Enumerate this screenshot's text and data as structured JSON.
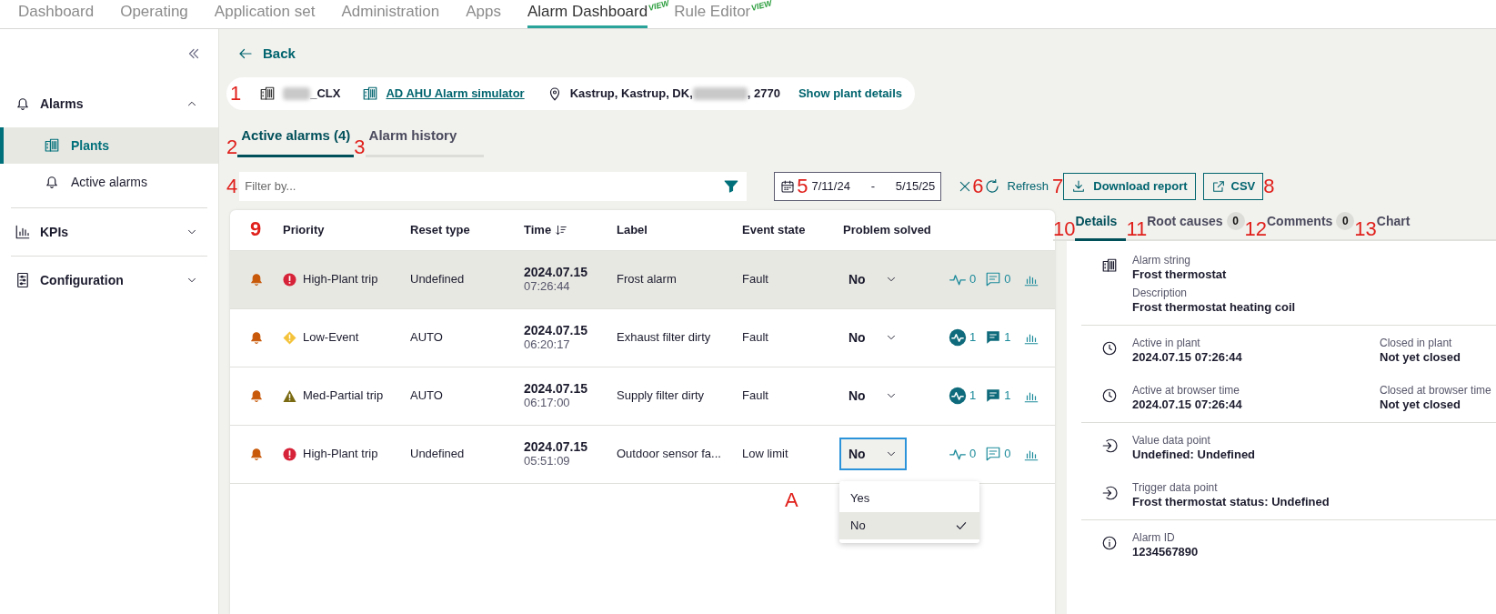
{
  "nav": [
    {
      "label": "Dashboard",
      "selected": false
    },
    {
      "label": "Operating",
      "selected": false
    },
    {
      "label": "Application set",
      "selected": false
    },
    {
      "label": "Administration",
      "selected": false
    },
    {
      "label": "Apps",
      "selected": false
    },
    {
      "label": "Alarm Dashboard",
      "selected": true,
      "badge": "VIEW"
    },
    {
      "label": "Rule Editor",
      "selected": false,
      "badge": "VIEW"
    }
  ],
  "sidebar": {
    "groups": [
      {
        "label": "Alarms",
        "expanded": true,
        "children": [
          {
            "label": "Plants",
            "selected": true
          },
          {
            "label": "Active alarms",
            "selected": false
          }
        ]
      },
      {
        "label": "KPIs",
        "expanded": false
      },
      {
        "label": "Configuration",
        "expanded": false
      }
    ]
  },
  "back": "Back",
  "plant_bar": {
    "callout": "1",
    "site": "_CLX",
    "plant_link": "AD AHU Alarm simulator",
    "address_start": "Kastrup, Kastrup, DK,",
    "address_end": ", 2770",
    "details_link": "Show plant details"
  },
  "tabs": [
    {
      "callout": "2",
      "label": "Active alarms (4)",
      "selected": true
    },
    {
      "callout": "3",
      "label": "Alarm history",
      "selected": false
    }
  ],
  "filter": {
    "callout": "4",
    "placeholder": "Filter by..."
  },
  "date_range": {
    "callout": "5",
    "from": "7/11/24",
    "separator": "-",
    "to": "5/15/25"
  },
  "clear_callout": "6",
  "refresh": {
    "label": "Refresh"
  },
  "download": {
    "callout": "7",
    "label": "Download report"
  },
  "csv": {
    "callout": "8",
    "label": "CSV"
  },
  "table": {
    "callout": "9",
    "columns": [
      {
        "label": "Priority"
      },
      {
        "label": "Reset type"
      },
      {
        "label": "Time",
        "sorted": true
      },
      {
        "label": "Label"
      },
      {
        "label": "Event state"
      },
      {
        "label": "Problem solved"
      }
    ],
    "rows": [
      {
        "kind": "high",
        "priority": "High-Plant trip",
        "reset_type": "Undefined",
        "date": "2024.07.15",
        "time": "07:26:44",
        "label": "Frost alarm",
        "event_state": "Fault",
        "solved": "No",
        "selected": true,
        "focused": false,
        "trend_count": "0",
        "trend_filled": false,
        "comment_count": "0",
        "comment_filled": false
      },
      {
        "kind": "low",
        "priority": "Low-Event",
        "reset_type": "AUTO",
        "date": "2024.07.15",
        "time": "06:20:17",
        "label": "Exhaust filter dirty",
        "event_state": "Fault",
        "solved": "No",
        "selected": false,
        "focused": false,
        "trend_count": "1",
        "trend_filled": true,
        "comment_count": "1",
        "comment_filled": true
      },
      {
        "kind": "med",
        "priority": "Med-Partial trip",
        "reset_type": "AUTO",
        "date": "2024.07.15",
        "time": "06:17:00",
        "label": "Supply filter dirty",
        "event_state": "Fault",
        "solved": "No",
        "selected": false,
        "focused": false,
        "trend_count": "1",
        "trend_filled": true,
        "comment_count": "1",
        "comment_filled": true
      },
      {
        "kind": "high",
        "priority": "High-Plant trip",
        "reset_type": "Undefined",
        "date": "2024.07.15",
        "time": "05:51:09",
        "label": "Outdoor sensor fa...",
        "event_state": "Low limit",
        "solved": "No",
        "selected": false,
        "focused": true,
        "trend_count": "0",
        "trend_filled": false,
        "comment_count": "0",
        "comment_filled": false
      }
    ]
  },
  "dropdown": {
    "callout": "A",
    "options": [
      {
        "label": "Yes",
        "selected": false
      },
      {
        "label": "No",
        "selected": true
      }
    ]
  },
  "detail_tabs": [
    {
      "callout": "10",
      "label": "Details",
      "selected": true
    },
    {
      "callout": "11",
      "label": "Root causes",
      "count": "0",
      "selected": false
    },
    {
      "callout": "12",
      "label": "Comments",
      "count": "0",
      "selected": false
    },
    {
      "callout": "13",
      "label": "Chart",
      "selected": false
    }
  ],
  "details": {
    "sections": [
      {
        "rows": [
          {
            "kind": "alarm",
            "cols": [
              {
                "label": "Alarm string",
                "value": "Frost thermostat"
              }
            ]
          },
          {
            "kind": "plain",
            "cols": [
              {
                "label": "Description",
                "value": "Frost thermostat heating coil"
              }
            ]
          }
        ]
      },
      {
        "rows": [
          {
            "kind": "time",
            "cols": [
              {
                "label": "Active in plant",
                "value": "2024.07.15 07:26:44"
              },
              {
                "label": "Closed in plant",
                "value": "Not yet closed"
              }
            ]
          },
          {
            "kind": "time",
            "cols": [
              {
                "label": "Active at browser time",
                "value": "2024.07.15 07:26:44"
              },
              {
                "label": "Closed at browser time",
                "value": "Not yet closed"
              }
            ]
          }
        ]
      },
      {
        "rows": [
          {
            "kind": "datapoint",
            "cols": [
              {
                "label": "Value data point",
                "value": "Undefined: Undefined"
              }
            ]
          },
          {
            "kind": "datapoint",
            "cols": [
              {
                "label": "Trigger data point",
                "value": "Frost thermostat status: Undefined"
              }
            ]
          }
        ]
      },
      {
        "rows": [
          {
            "kind": "info",
            "cols": [
              {
                "label": "Alarm ID",
                "value": "1234567890"
              }
            ]
          }
        ]
      }
    ]
  }
}
